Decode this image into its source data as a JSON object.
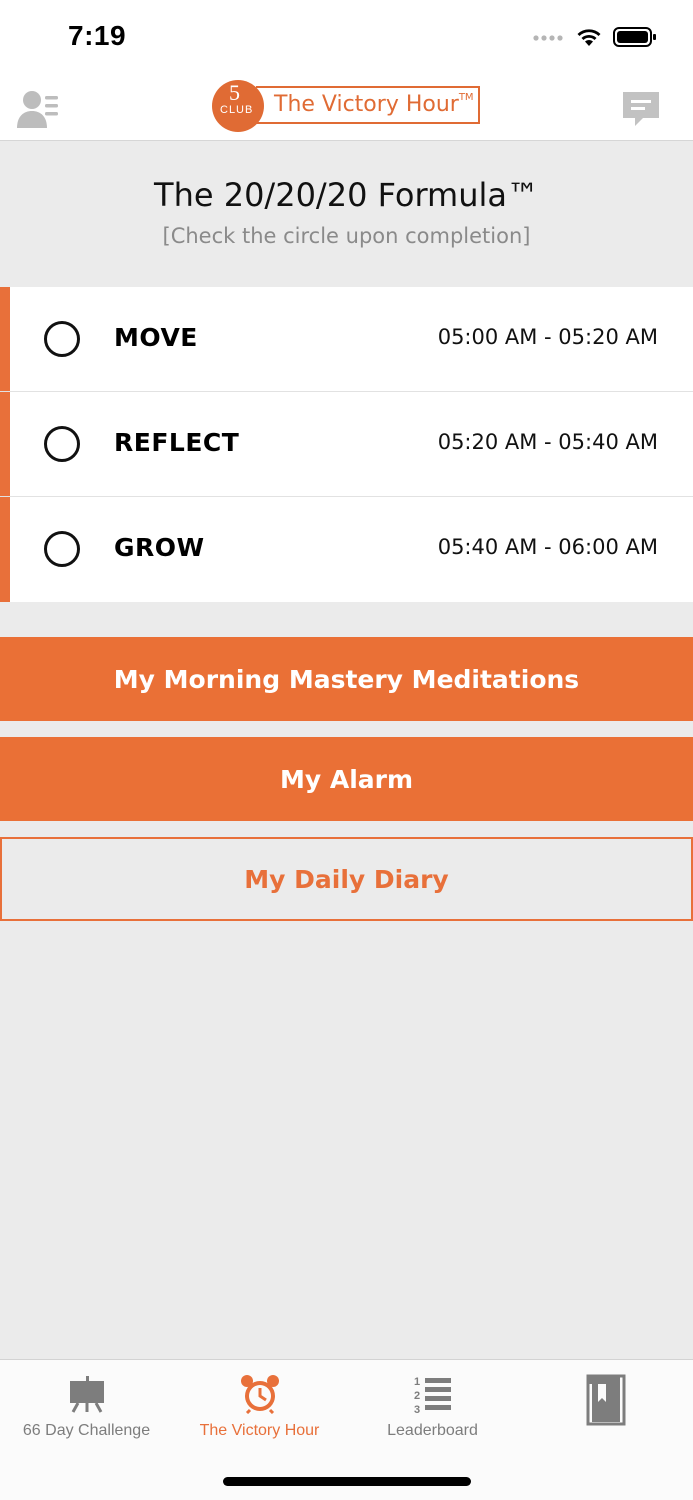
{
  "status_bar": {
    "time": "7:19"
  },
  "header": {
    "logo_number": "5",
    "logo_club": "CLUB",
    "logo_title": "The Victory Hour",
    "logo_tm": "TM"
  },
  "formula": {
    "title": "The 20/20/20 Formula™",
    "subtitle": "[Check the circle upon completion]"
  },
  "tasks": [
    {
      "name": "MOVE",
      "time": "05:00 AM - 05:20 AM",
      "checked": false
    },
    {
      "name": "REFLECT",
      "time": "05:20 AM - 05:40 AM",
      "checked": false
    },
    {
      "name": "GROW",
      "time": "05:40 AM - 06:00 AM",
      "checked": false
    }
  ],
  "buttons": {
    "meditations": "My Morning Mastery Meditations",
    "alarm": "My Alarm",
    "diary": "My Daily Diary"
  },
  "tab_bar": {
    "tabs": [
      {
        "label": "66 Day Challenge",
        "icon": "easel-icon",
        "active": false
      },
      {
        "label": "The Victory Hour",
        "icon": "alarm-clock-icon",
        "active": true
      },
      {
        "label": "Leaderboard",
        "icon": "numbered-list-icon",
        "active": false
      },
      {
        "label": "",
        "icon": "bookmark-book-icon",
        "active": false
      }
    ]
  },
  "colors": {
    "accent": "#ea7036",
    "background": "#ebebeb",
    "inactive_tab": "#7d7d7d"
  }
}
